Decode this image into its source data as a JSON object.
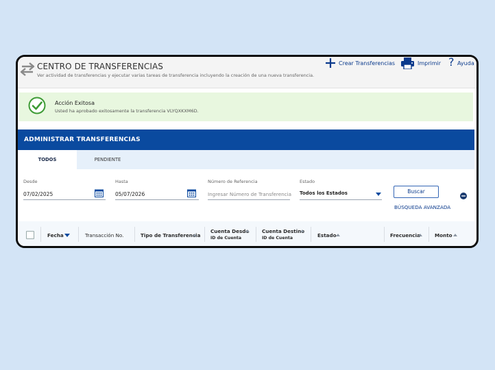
{
  "header": {
    "title": "CENTRO DE TRANSFERENCIAS",
    "subtitle": "Ver actividad de transferencias y ejecutar varias tareas de transferencia incluyendo la creación de una nueva transferencia.",
    "actions": {
      "create": "Crear Transferencias",
      "print": "Imprimir",
      "help": "Ayuda"
    }
  },
  "alert": {
    "title": "Acción Exitosa",
    "message": "Usted ha aprobado exitosamente la transferencia VLYQXKXM6D."
  },
  "section_title": "ADMINISTRAR TRANSFERENCIAS",
  "tabs": [
    {
      "label": "TODOS",
      "active": true
    },
    {
      "label": "PENDIENTE",
      "active": false
    }
  ],
  "filters": {
    "from": {
      "label": "Desde",
      "value": "07/02/2025"
    },
    "to": {
      "label": "Hasta",
      "value": "05/07/2026"
    },
    "reference": {
      "label": "Número de Referencia",
      "placeholder": "Ingresar Número de Transferencia"
    },
    "status": {
      "label": "Estado",
      "value": "Todos los Estados"
    },
    "search_button": "Buscar",
    "advanced_link": "BÚSQUEDA AVANZADA"
  },
  "table": {
    "columns": {
      "fecha": "Fecha",
      "transaccion": "Transacción No.",
      "tipo": "Tipo de Transferencia",
      "cuenta_desde": "Cuenta Desde",
      "cuenta_desde_sub": "ID de Cuenta",
      "cuenta_destino": "Cuenta Destino",
      "cuenta_destino_sub": "ID de Cuenta",
      "estado": "Estado",
      "frecuencia": "Frecuencia",
      "monto": "Monto"
    }
  },
  "colors": {
    "brand_blue": "#0a4a9f",
    "success_bg": "#e8f7df",
    "check_green": "#3d9b35",
    "page_bg": "#d3e4f6"
  }
}
